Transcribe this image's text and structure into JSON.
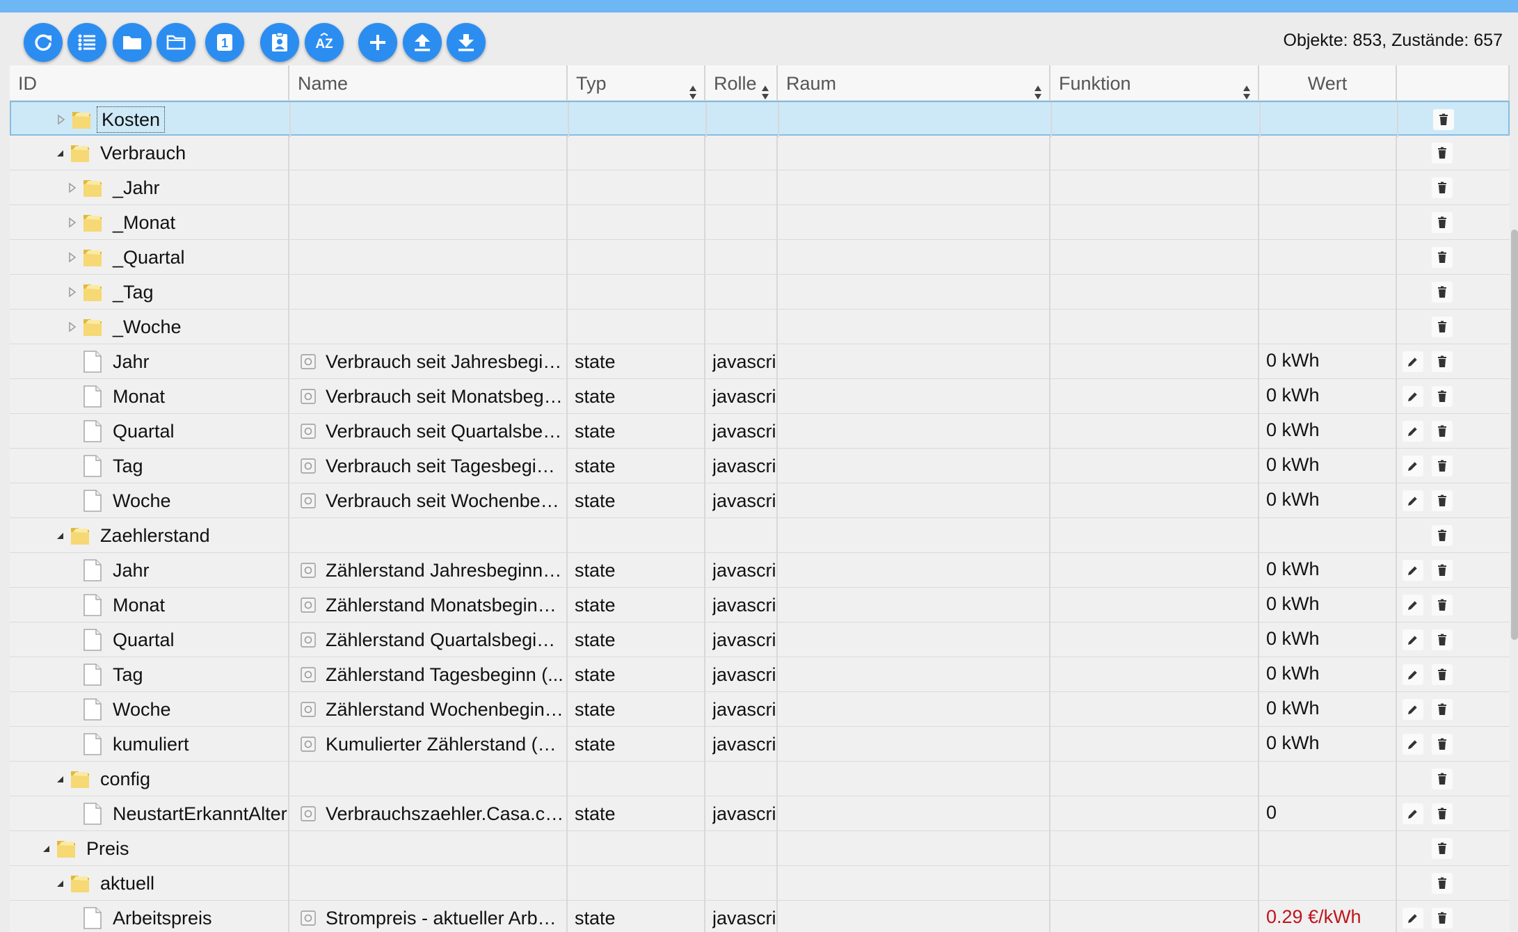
{
  "toolbar": {
    "buttons": [
      {
        "name": "refresh-button",
        "icon": "refresh-icon"
      },
      {
        "name": "list-view-button",
        "icon": "list-icon"
      },
      {
        "name": "folder-closed-button",
        "icon": "folder-filled-icon"
      },
      {
        "name": "folder-open-button",
        "icon": "folder-outline-icon"
      },
      {
        "name": "number-one-button",
        "icon": "number-one-icon"
      },
      {
        "name": "contact-card-button",
        "icon": "contact-card-icon"
      },
      {
        "name": "sort-az-button",
        "icon": "sort-az-icon"
      },
      {
        "name": "add-button",
        "icon": "plus-icon"
      },
      {
        "name": "upload-button",
        "icon": "upload-icon"
      },
      {
        "name": "download-button",
        "icon": "download-icon"
      }
    ],
    "number_one_label": "1",
    "sort_az_label": "AZ",
    "counts": "Objekte: 853, Zustände: 657"
  },
  "colors": {
    "accent": "#2c8df1",
    "topbar": "#6fb6f5",
    "selected_row": "#cde9f7",
    "price_value": "#c0141c"
  },
  "table": {
    "columns": [
      {
        "key": "id",
        "label": "ID",
        "sortable": false
      },
      {
        "key": "name",
        "label": "Name",
        "sortable": false
      },
      {
        "key": "typ",
        "label": "Typ",
        "sortable": true
      },
      {
        "key": "rolle",
        "label": "Rolle",
        "sortable": true
      },
      {
        "key": "raum",
        "label": "Raum",
        "sortable": true
      },
      {
        "key": "funktion",
        "label": "Funktion",
        "sortable": true
      },
      {
        "key": "wert",
        "label": "Wert",
        "sortable": false
      },
      {
        "key": "actions",
        "label": "",
        "sortable": false
      }
    ],
    "rows": [
      {
        "level": 1,
        "kind": "folder",
        "expanded": false,
        "id": "Kosten",
        "selected": true
      },
      {
        "level": 1,
        "kind": "folder",
        "expanded": true,
        "id": "Verbrauch"
      },
      {
        "level": 2,
        "kind": "folder",
        "expanded": false,
        "id": "_Jahr"
      },
      {
        "level": 2,
        "kind": "folder",
        "expanded": false,
        "id": "_Monat"
      },
      {
        "level": 2,
        "kind": "folder",
        "expanded": false,
        "id": "_Quartal"
      },
      {
        "level": 2,
        "kind": "folder",
        "expanded": false,
        "id": "_Tag"
      },
      {
        "level": 2,
        "kind": "folder",
        "expanded": false,
        "id": "_Woche"
      },
      {
        "level": 2,
        "kind": "state",
        "id": "Jahr",
        "name": "Verbrauch seit Jahresbegin...",
        "typ": "state",
        "rolle": "javascript",
        "wert": "0 kWh"
      },
      {
        "level": 2,
        "kind": "state",
        "id": "Monat",
        "name": "Verbrauch seit Monatsbegin...",
        "typ": "state",
        "rolle": "javascript",
        "wert": "0 kWh"
      },
      {
        "level": 2,
        "kind": "state",
        "id": "Quartal",
        "name": "Verbrauch seit Quartalsbegi...",
        "typ": "state",
        "rolle": "javascript",
        "wert": "0 kWh"
      },
      {
        "level": 2,
        "kind": "state",
        "id": "Tag",
        "name": "Verbrauch seit Tagesbeginn...",
        "typ": "state",
        "rolle": "javascript",
        "wert": "0 kWh"
      },
      {
        "level": 2,
        "kind": "state",
        "id": "Woche",
        "name": "Verbrauch seit Wochenbegi...",
        "typ": "state",
        "rolle": "javascript",
        "wert": "0 kWh"
      },
      {
        "level": 1,
        "kind": "folder",
        "expanded": true,
        "id": "Zaehlerstand"
      },
      {
        "level": 2,
        "kind": "state",
        "id": "Jahr",
        "name": "Zählerstand Jahresbeginn (...",
        "typ": "state",
        "rolle": "javascript",
        "wert": "0 kWh"
      },
      {
        "level": 2,
        "kind": "state",
        "id": "Monat",
        "name": "Zählerstand Monatsbeginn ...",
        "typ": "state",
        "rolle": "javascript",
        "wert": "0 kWh"
      },
      {
        "level": 2,
        "kind": "state",
        "id": "Quartal",
        "name": "Zählerstand Quartalsbeginn...",
        "typ": "state",
        "rolle": "javascript",
        "wert": "0 kWh"
      },
      {
        "level": 2,
        "kind": "state",
        "id": "Tag",
        "name": "Zählerstand Tagesbeginn (...",
        "typ": "state",
        "rolle": "javascript",
        "wert": "0 kWh"
      },
      {
        "level": 2,
        "kind": "state",
        "id": "Woche",
        "name": "Zählerstand Wochenbeginn...",
        "typ": "state",
        "rolle": "javascript",
        "wert": "0 kWh"
      },
      {
        "level": 2,
        "kind": "state",
        "id": "kumuliert",
        "name": "Kumulierter Zählerstand (C...",
        "typ": "state",
        "rolle": "javascript",
        "wert": "0 kWh"
      },
      {
        "level": 1,
        "kind": "folder",
        "expanded": true,
        "id": "config"
      },
      {
        "level": 2,
        "kind": "state",
        "id": "NeustartErkanntAlter",
        "name": "Verbrauchszaehler.Casa.con...",
        "typ": "state",
        "rolle": "javascript",
        "wert": "0"
      },
      {
        "level": 0,
        "kind": "folder",
        "expanded": true,
        "id": "Preis"
      },
      {
        "level": 1,
        "kind": "folder",
        "expanded": true,
        "id": "aktuell"
      },
      {
        "level": 2,
        "kind": "state",
        "id": "Arbeitspreis",
        "name": "Strompreis - aktueller Arbei...",
        "typ": "state",
        "rolle": "javascript",
        "wert": "0.29 €/kWh",
        "wert_color": "#c0141c"
      }
    ]
  }
}
